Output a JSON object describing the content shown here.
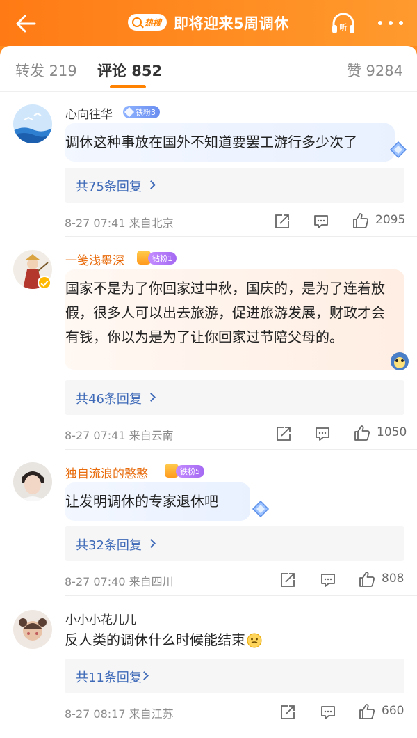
{
  "header": {
    "hot_tag": "热搜",
    "title": "即将迎来5周调休"
  },
  "tabs": [
    {
      "label": "转发 219"
    },
    {
      "label": "评论 852"
    },
    {
      "label": "赞 9284"
    }
  ],
  "comments": [
    {
      "name": "心向往华",
      "fan_badge": "铁粉3",
      "text": "调休这种事放在国外不知道要罢工游行多少次了",
      "replies": "共75条回复",
      "meta": "8-27 07:41  来自北京",
      "likes": "2095"
    },
    {
      "name": "一笺浅墨深",
      "fan_badge": "钻粉1",
      "text": "国家不是为了你回家过中秋，国庆的，是为了连着放假，很多人可以出去旅游，促进旅游发展，财政才会有钱，你以为是为了让你回家过节陪父母的。",
      "replies": "共46条回复",
      "meta": "8-27 07:41  来自云南",
      "likes": "1050"
    },
    {
      "name": "独自流浪的憨憨",
      "fan_badge": "铁粉5",
      "text": "让发明调休的专家退休吧",
      "replies": "共32条回复",
      "meta": "8-27 07:40  来自四川",
      "likes": "808"
    },
    {
      "name": "小小小花儿儿",
      "text": "反人类的调休什么时候能结束",
      "replies": "共11条回复",
      "meta": "8-27 08:17  来自江苏",
      "likes": "660"
    }
  ]
}
